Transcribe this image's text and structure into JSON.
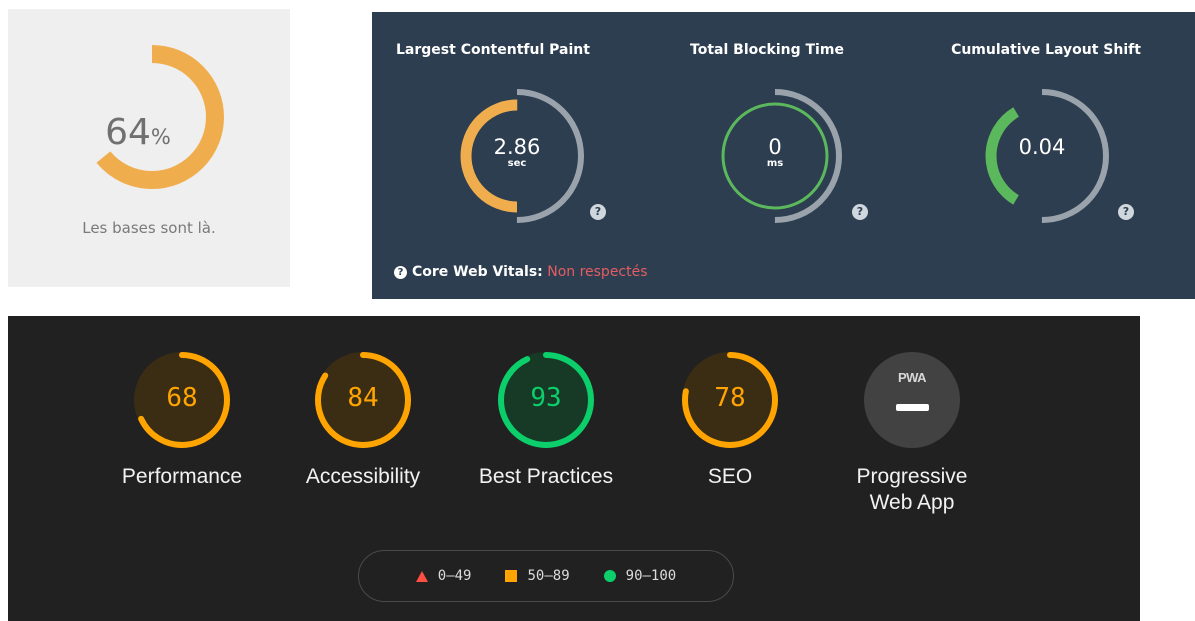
{
  "basic_score": {
    "value": "64",
    "unit": "%",
    "fraction": 0.64,
    "caption": "Les bases sont là.",
    "color": "#f0ad4e"
  },
  "core_web_vitals": {
    "metrics": [
      {
        "title": "Largest Contentful Paint",
        "value": "2.86",
        "unit": "sec",
        "fill_fraction": 0.5,
        "color": "#f0ad4e",
        "help": "?"
      },
      {
        "title": "Total Blocking Time",
        "value": "0",
        "unit": "ms",
        "fill_fraction": 1.0,
        "color": "#5cb85c",
        "help": "?"
      },
      {
        "title": "Cumulative Layout Shift",
        "value": "0.04",
        "unit": "",
        "fill_fraction": 0.33,
        "color": "#5cb85c",
        "help": "?"
      }
    ],
    "status_label": "Core Web Vitals:",
    "status_value": "Non respectés",
    "status_color": "#e35d62",
    "help": "?"
  },
  "lighthouse": {
    "categories": [
      {
        "label": "Performance",
        "score": 68,
        "color": "#ffa400"
      },
      {
        "label": "Accessibility",
        "score": 84,
        "color": "#ffa400"
      },
      {
        "label": "Best Practices",
        "score": 93,
        "color": "#0cce6b"
      },
      {
        "label": "SEO",
        "score": 78,
        "color": "#ffa400"
      }
    ],
    "pwa": {
      "badge_text": "PWA",
      "label_line1": "Progressive",
      "label_line2": "Web App"
    },
    "legend": [
      {
        "shape": "triangle",
        "range": "0–49",
        "color": "#ff4e42"
      },
      {
        "shape": "square",
        "range": "50–89",
        "color": "#ffa400"
      },
      {
        "shape": "circle",
        "range": "90–100",
        "color": "#0cce6b"
      }
    ]
  }
}
